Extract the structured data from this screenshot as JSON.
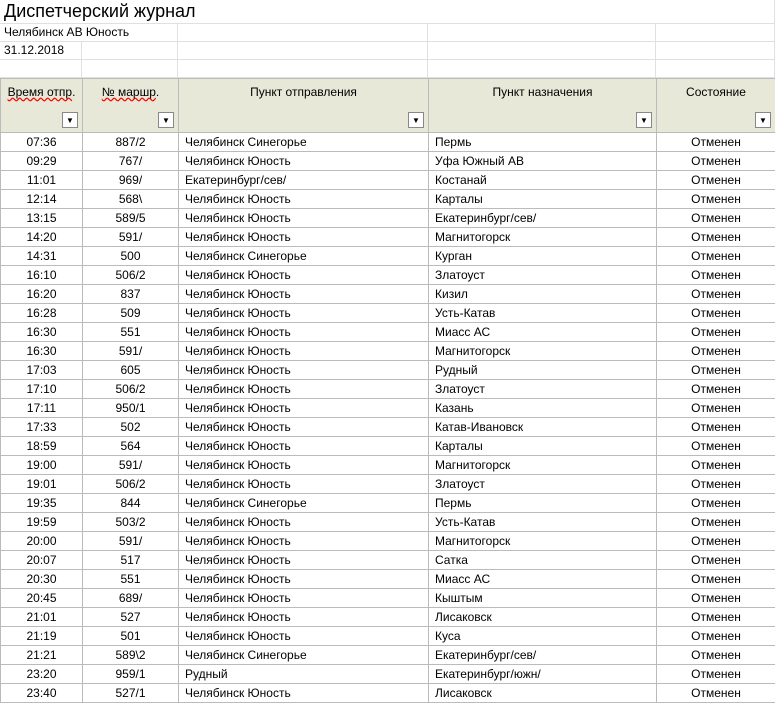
{
  "title": "Диспетчерский журнал",
  "subtitle": "Челябинск АВ Юность",
  "date": "31.12.2018",
  "columns": {
    "time": "Время отпр",
    "route": "№ маршр",
    "departure": "Пункт отправления",
    "destination": "Пункт назначения",
    "status": "Состояние"
  },
  "rows": [
    {
      "time": "07:36",
      "route": "887/2",
      "dep": "Челябинск Синегорье",
      "dest": "Пермь",
      "status": "Отменен"
    },
    {
      "time": "09:29",
      "route": "767/",
      "dep": "Челябинск Юность",
      "dest": "Уфа Южный АВ",
      "status": "Отменен"
    },
    {
      "time": "11:01",
      "route": "969/",
      "dep": "Екатеринбург/сев/",
      "dest": "Костанай",
      "status": "Отменен"
    },
    {
      "time": "12:14",
      "route": "568\\",
      "dep": "Челябинск Юность",
      "dest": "Карталы",
      "status": "Отменен"
    },
    {
      "time": "13:15",
      "route": "589/5",
      "dep": "Челябинск Юность",
      "dest": "Екатеринбург/сев/",
      "status": "Отменен"
    },
    {
      "time": "14:20",
      "route": "591/",
      "dep": "Челябинск Юность",
      "dest": "Магнитогорск",
      "status": "Отменен"
    },
    {
      "time": "14:31",
      "route": "500",
      "dep": "Челябинск Синегорье",
      "dest": "Курган",
      "status": "Отменен"
    },
    {
      "time": "16:10",
      "route": "506/2",
      "dep": "Челябинск Юность",
      "dest": "Златоуст",
      "status": "Отменен"
    },
    {
      "time": "16:20",
      "route": "837",
      "dep": "Челябинск Юность",
      "dest": "Кизил",
      "status": "Отменен"
    },
    {
      "time": "16:28",
      "route": "509",
      "dep": "Челябинск Юность",
      "dest": "Усть-Катав",
      "status": "Отменен"
    },
    {
      "time": "16:30",
      "route": "551",
      "dep": "Челябинск Юность",
      "dest": "Миасс АС",
      "status": "Отменен"
    },
    {
      "time": "16:30",
      "route": "591/",
      "dep": "Челябинск Юность",
      "dest": "Магнитогорск",
      "status": "Отменен"
    },
    {
      "time": "17:03",
      "route": "605",
      "dep": "Челябинск Юность",
      "dest": "Рудный",
      "status": "Отменен"
    },
    {
      "time": "17:10",
      "route": "506/2",
      "dep": "Челябинск Юность",
      "dest": "Златоуст",
      "status": "Отменен"
    },
    {
      "time": "17:11",
      "route": "950/1",
      "dep": "Челябинск Юность",
      "dest": "Казань",
      "status": "Отменен"
    },
    {
      "time": "17:33",
      "route": "502",
      "dep": "Челябинск Юность",
      "dest": "Катав-Ивановск",
      "status": "Отменен"
    },
    {
      "time": "18:59",
      "route": "564",
      "dep": "Челябинск Юность",
      "dest": "Карталы",
      "status": "Отменен"
    },
    {
      "time": "19:00",
      "route": "591/",
      "dep": "Челябинск Юность",
      "dest": "Магнитогорск",
      "status": "Отменен"
    },
    {
      "time": "19:01",
      "route": "506/2",
      "dep": "Челябинск Юность",
      "dest": "Златоуст",
      "status": "Отменен"
    },
    {
      "time": "19:35",
      "route": "844",
      "dep": "Челябинск Синегорье",
      "dest": "Пермь",
      "status": "Отменен"
    },
    {
      "time": "19:59",
      "route": "503/2",
      "dep": "Челябинск Юность",
      "dest": "Усть-Катав",
      "status": "Отменен"
    },
    {
      "time": "20:00",
      "route": "591/",
      "dep": "Челябинск Юность",
      "dest": "Магнитогорск",
      "status": "Отменен"
    },
    {
      "time": "20:07",
      "route": "517",
      "dep": "Челябинск Юность",
      "dest": "Сатка",
      "status": "Отменен"
    },
    {
      "time": "20:30",
      "route": "551",
      "dep": "Челябинск Юность",
      "dest": "Миасс АС",
      "status": "Отменен"
    },
    {
      "time": "20:45",
      "route": "689/",
      "dep": "Челябинск Юность",
      "dest": "Кыштым",
      "status": "Отменен"
    },
    {
      "time": "21:01",
      "route": "527",
      "dep": "Челябинск Юность",
      "dest": "Лисаковск",
      "status": "Отменен"
    },
    {
      "time": "21:19",
      "route": "501",
      "dep": "Челябинск Юность",
      "dest": "Куса",
      "status": "Отменен"
    },
    {
      "time": "21:21",
      "route": "589\\2",
      "dep": "Челябинск Синегорье",
      "dest": "Екатеринбург/сев/",
      "status": "Отменен"
    },
    {
      "time": "23:20",
      "route": "959/1",
      "dep": "Рудный",
      "dest": "Екатеринбург/южн/",
      "status": "Отменен"
    },
    {
      "time": "23:40",
      "route": "527/1",
      "dep": "Челябинск Юность",
      "dest": "Лисаковск",
      "status": "Отменен"
    }
  ]
}
